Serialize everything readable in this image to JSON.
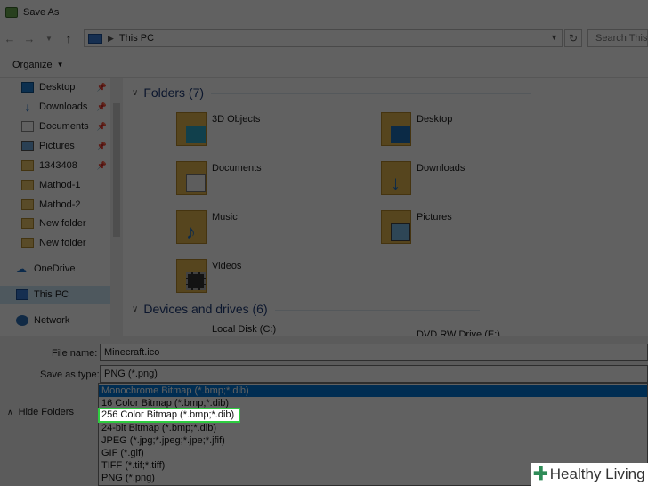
{
  "window": {
    "title": "Save As"
  },
  "address": {
    "location": "This PC",
    "search_placeholder": "Search This PC"
  },
  "toolbar": {
    "organize_label": "Organize"
  },
  "sidebar": {
    "quick_access": [
      {
        "label": "Desktop",
        "icon": "desktop-icon",
        "pinned": true
      },
      {
        "label": "Downloads",
        "icon": "download-arrow-icon",
        "pinned": true
      },
      {
        "label": "Documents",
        "icon": "documents-icon",
        "pinned": true
      },
      {
        "label": "Pictures",
        "icon": "pictures-icon",
        "pinned": true
      },
      {
        "label": "1343408",
        "icon": "folder-icon",
        "pinned": true
      },
      {
        "label": "Mathod-1",
        "icon": "folder-icon",
        "pinned": false
      },
      {
        "label": "Mathod-2",
        "icon": "folder-icon",
        "pinned": false
      },
      {
        "label": "New folder",
        "icon": "folder-icon",
        "pinned": false
      },
      {
        "label": "New folder",
        "icon": "folder-icon",
        "pinned": false
      }
    ],
    "onedrive": "OneDrive",
    "this_pc": "This PC",
    "network": "Network"
  },
  "content": {
    "folders_header": "Folders (7)",
    "folders": [
      {
        "label": "3D Objects",
        "icon": "3d-objects-folder-icon"
      },
      {
        "label": "Desktop",
        "icon": "desktop-folder-icon"
      },
      {
        "label": "Documents",
        "icon": "documents-folder-icon"
      },
      {
        "label": "Downloads",
        "icon": "downloads-folder-icon"
      },
      {
        "label": "Music",
        "icon": "music-folder-icon"
      },
      {
        "label": "Pictures",
        "icon": "pictures-folder-icon"
      },
      {
        "label": "Videos",
        "icon": "videos-folder-icon"
      }
    ],
    "drives_header": "Devices and drives (6)",
    "drives": [
      {
        "label": "Local Disk (C:)"
      },
      {
        "label": "DVD RW Drive (E:)"
      }
    ]
  },
  "bottom": {
    "file_name_label": "File name:",
    "file_name_value": "Minecraft.ico",
    "save_type_label": "Save as type:",
    "save_type_value": "PNG (*.png)",
    "hide_folders": "Hide Folders"
  },
  "type_options": [
    {
      "label": "Monochrome Bitmap (*.bmp;*.dib)",
      "highlighted": true
    },
    {
      "label": "16 Color Bitmap (*.bmp;*.dib)",
      "highlighted": false
    },
    {
      "label": "256 Color Bitmap (*.bmp;*.dib)",
      "highlighted": false
    },
    {
      "label": "24-bit Bitmap (*.bmp;*.dib)",
      "highlighted": false
    },
    {
      "label": "JPEG (*.jpg;*.jpeg;*.jpe;*.jfif)",
      "highlighted": false
    },
    {
      "label": "GIF (*.gif)",
      "highlighted": false
    },
    {
      "label": "TIFF (*.tif;*.tiff)",
      "highlighted": false
    },
    {
      "label": "PNG (*.png)",
      "highlighted": false
    }
  ],
  "focused_option": "256 Color Bitmap (*.bmp;*.dib)",
  "watermark": {
    "text": "Healthy Living"
  },
  "colors": {
    "highlight": "#0078d7",
    "focus_outline": "#2ecc40",
    "brand_green": "#2e8b57"
  }
}
